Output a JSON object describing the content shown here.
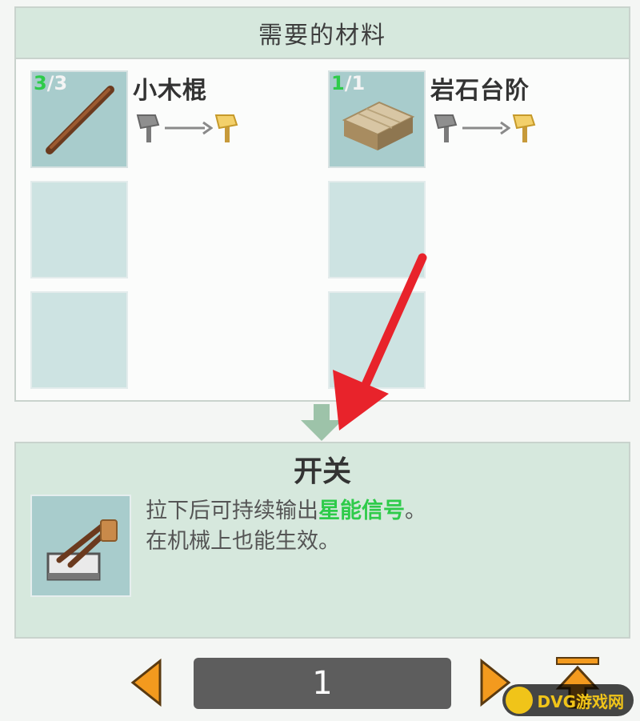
{
  "materials": {
    "header": "需要的材料",
    "items": [
      {
        "name": "小木棍",
        "have": "3",
        "need": "/3",
        "icon": "stick-icon"
      },
      {
        "name": "岩石台阶",
        "have": "1",
        "need": "/1",
        "icon": "stone-slab-icon"
      }
    ]
  },
  "result": {
    "title": "开关",
    "desc_line1_prefix": "拉下后可持续输出",
    "desc_line1_highlight": "星能信号",
    "desc_line1_suffix": "。",
    "desc_line2": "在机械上也能生效。",
    "icon": "lever-icon"
  },
  "pagination": {
    "page": "1"
  },
  "watermark": {
    "text": "DVG游戏网"
  },
  "colors": {
    "accent_green": "#2ecb4a",
    "arrow_orange": "#f39a1e",
    "annotation_red": "#e8232b"
  }
}
